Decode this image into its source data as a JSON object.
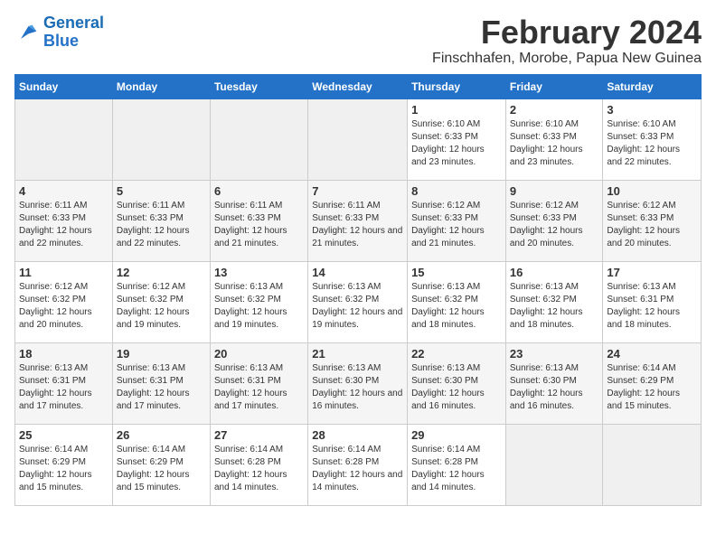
{
  "logo": {
    "line1": "General",
    "line2": "Blue"
  },
  "title": "February 2024",
  "location": "Finschhafen, Morobe, Papua New Guinea",
  "days_of_week": [
    "Sunday",
    "Monday",
    "Tuesday",
    "Wednesday",
    "Thursday",
    "Friday",
    "Saturday"
  ],
  "weeks": [
    [
      {
        "day": "",
        "info": ""
      },
      {
        "day": "",
        "info": ""
      },
      {
        "day": "",
        "info": ""
      },
      {
        "day": "",
        "info": ""
      },
      {
        "day": "1",
        "info": "Sunrise: 6:10 AM\nSunset: 6:33 PM\nDaylight: 12 hours and 23 minutes."
      },
      {
        "day": "2",
        "info": "Sunrise: 6:10 AM\nSunset: 6:33 PM\nDaylight: 12 hours and 23 minutes."
      },
      {
        "day": "3",
        "info": "Sunrise: 6:10 AM\nSunset: 6:33 PM\nDaylight: 12 hours and 22 minutes."
      }
    ],
    [
      {
        "day": "4",
        "info": "Sunrise: 6:11 AM\nSunset: 6:33 PM\nDaylight: 12 hours and 22 minutes."
      },
      {
        "day": "5",
        "info": "Sunrise: 6:11 AM\nSunset: 6:33 PM\nDaylight: 12 hours and 22 minutes."
      },
      {
        "day": "6",
        "info": "Sunrise: 6:11 AM\nSunset: 6:33 PM\nDaylight: 12 hours and 21 minutes."
      },
      {
        "day": "7",
        "info": "Sunrise: 6:11 AM\nSunset: 6:33 PM\nDaylight: 12 hours and 21 minutes."
      },
      {
        "day": "8",
        "info": "Sunrise: 6:12 AM\nSunset: 6:33 PM\nDaylight: 12 hours and 21 minutes."
      },
      {
        "day": "9",
        "info": "Sunrise: 6:12 AM\nSunset: 6:33 PM\nDaylight: 12 hours and 20 minutes."
      },
      {
        "day": "10",
        "info": "Sunrise: 6:12 AM\nSunset: 6:33 PM\nDaylight: 12 hours and 20 minutes."
      }
    ],
    [
      {
        "day": "11",
        "info": "Sunrise: 6:12 AM\nSunset: 6:32 PM\nDaylight: 12 hours and 20 minutes."
      },
      {
        "day": "12",
        "info": "Sunrise: 6:12 AM\nSunset: 6:32 PM\nDaylight: 12 hours and 19 minutes."
      },
      {
        "day": "13",
        "info": "Sunrise: 6:13 AM\nSunset: 6:32 PM\nDaylight: 12 hours and 19 minutes."
      },
      {
        "day": "14",
        "info": "Sunrise: 6:13 AM\nSunset: 6:32 PM\nDaylight: 12 hours and 19 minutes."
      },
      {
        "day": "15",
        "info": "Sunrise: 6:13 AM\nSunset: 6:32 PM\nDaylight: 12 hours and 18 minutes."
      },
      {
        "day": "16",
        "info": "Sunrise: 6:13 AM\nSunset: 6:32 PM\nDaylight: 12 hours and 18 minutes."
      },
      {
        "day": "17",
        "info": "Sunrise: 6:13 AM\nSunset: 6:31 PM\nDaylight: 12 hours and 18 minutes."
      }
    ],
    [
      {
        "day": "18",
        "info": "Sunrise: 6:13 AM\nSunset: 6:31 PM\nDaylight: 12 hours and 17 minutes."
      },
      {
        "day": "19",
        "info": "Sunrise: 6:13 AM\nSunset: 6:31 PM\nDaylight: 12 hours and 17 minutes."
      },
      {
        "day": "20",
        "info": "Sunrise: 6:13 AM\nSunset: 6:31 PM\nDaylight: 12 hours and 17 minutes."
      },
      {
        "day": "21",
        "info": "Sunrise: 6:13 AM\nSunset: 6:30 PM\nDaylight: 12 hours and 16 minutes."
      },
      {
        "day": "22",
        "info": "Sunrise: 6:13 AM\nSunset: 6:30 PM\nDaylight: 12 hours and 16 minutes."
      },
      {
        "day": "23",
        "info": "Sunrise: 6:13 AM\nSunset: 6:30 PM\nDaylight: 12 hours and 16 minutes."
      },
      {
        "day": "24",
        "info": "Sunrise: 6:14 AM\nSunset: 6:29 PM\nDaylight: 12 hours and 15 minutes."
      }
    ],
    [
      {
        "day": "25",
        "info": "Sunrise: 6:14 AM\nSunset: 6:29 PM\nDaylight: 12 hours and 15 minutes."
      },
      {
        "day": "26",
        "info": "Sunrise: 6:14 AM\nSunset: 6:29 PM\nDaylight: 12 hours and 15 minutes."
      },
      {
        "day": "27",
        "info": "Sunrise: 6:14 AM\nSunset: 6:28 PM\nDaylight: 12 hours and 14 minutes."
      },
      {
        "day": "28",
        "info": "Sunrise: 6:14 AM\nSunset: 6:28 PM\nDaylight: 12 hours and 14 minutes."
      },
      {
        "day": "29",
        "info": "Sunrise: 6:14 AM\nSunset: 6:28 PM\nDaylight: 12 hours and 14 minutes."
      },
      {
        "day": "",
        "info": ""
      },
      {
        "day": "",
        "info": ""
      }
    ]
  ]
}
